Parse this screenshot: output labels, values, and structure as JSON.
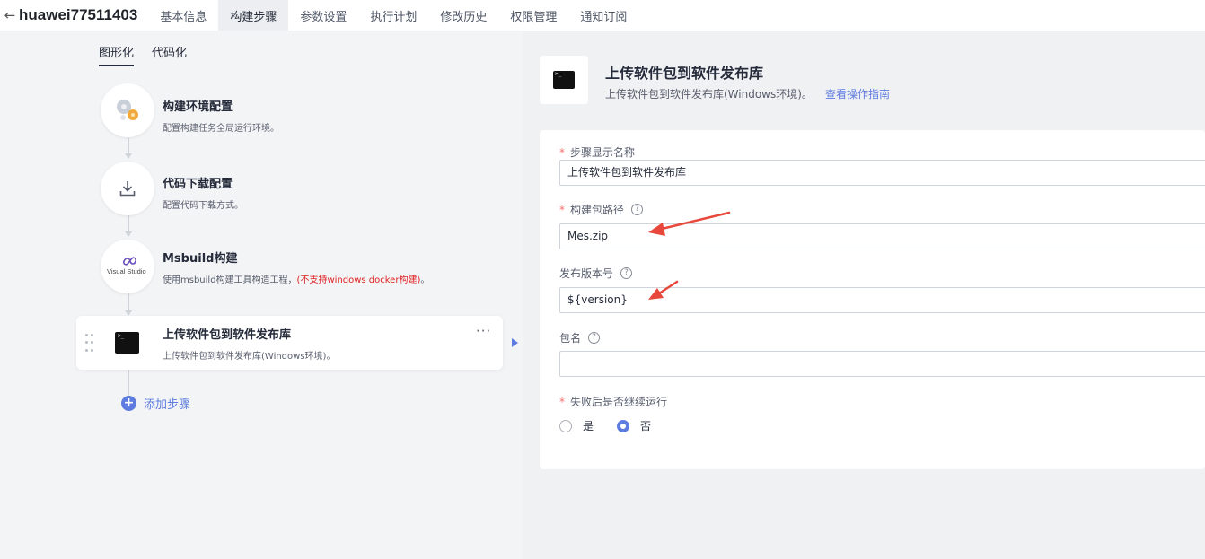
{
  "header": {
    "back_icon": "arrow-left-icon",
    "project_title": "huawei77511403",
    "tabs": [
      {
        "label": "基本信息",
        "active": false
      },
      {
        "label": "构建步骤",
        "active": true
      },
      {
        "label": "参数设置",
        "active": false
      },
      {
        "label": "执行计划",
        "active": false
      },
      {
        "label": "修改历史",
        "active": false
      },
      {
        "label": "权限管理",
        "active": false
      },
      {
        "label": "通知订阅",
        "active": false
      }
    ]
  },
  "left": {
    "subtabs": [
      {
        "label": "图形化",
        "active": true
      },
      {
        "label": "代码化",
        "active": false
      }
    ],
    "steps": [
      {
        "title": "构建环境配置",
        "desc": "配置构建任务全局运行环境。",
        "icon": "gears-icon"
      },
      {
        "title": "代码下载配置",
        "desc": "配置代码下载方式。",
        "icon": "download-icon"
      },
      {
        "title": "Msbuild构建",
        "desc": "使用msbuild构建工具构造工程，",
        "desc_warn": "(不支持windows docker构建)",
        "desc_tail": "。",
        "icon": "visual-studio-logo",
        "logo_text": "Visual Studio"
      },
      {
        "title": "上传软件包到软件发布库",
        "desc": "上传软件包到软件发布库(Windows环境)。",
        "icon": "terminal-icon",
        "selected": true
      }
    ],
    "add_step_label": "添加步骤",
    "more_label": "···"
  },
  "detail": {
    "title": "上传软件包到软件发布库",
    "desc": "上传软件包到软件发布库(Windows环境)。",
    "guide_link": "查看操作指南",
    "fields": {
      "step_name": {
        "label": "步骤显示名称",
        "required": true,
        "value": "上传软件包到软件发布库"
      },
      "package_path": {
        "label": "构建包路径",
        "required": true,
        "value": "Mes.zip"
      },
      "version": {
        "label": "发布版本号",
        "required": false,
        "value": "${version}"
      },
      "package_name": {
        "label": "包名",
        "required": false,
        "value": ""
      },
      "continue_on_fail": {
        "label": "失败后是否继续运行",
        "required": true,
        "options": [
          "是",
          "否"
        ],
        "selected": "否"
      }
    },
    "help_glyph": "?",
    "required_mark": "*"
  },
  "colors": {
    "accent": "#5e7ce0",
    "warn": "#e02020",
    "annotation_arrow": "#e8473b"
  }
}
